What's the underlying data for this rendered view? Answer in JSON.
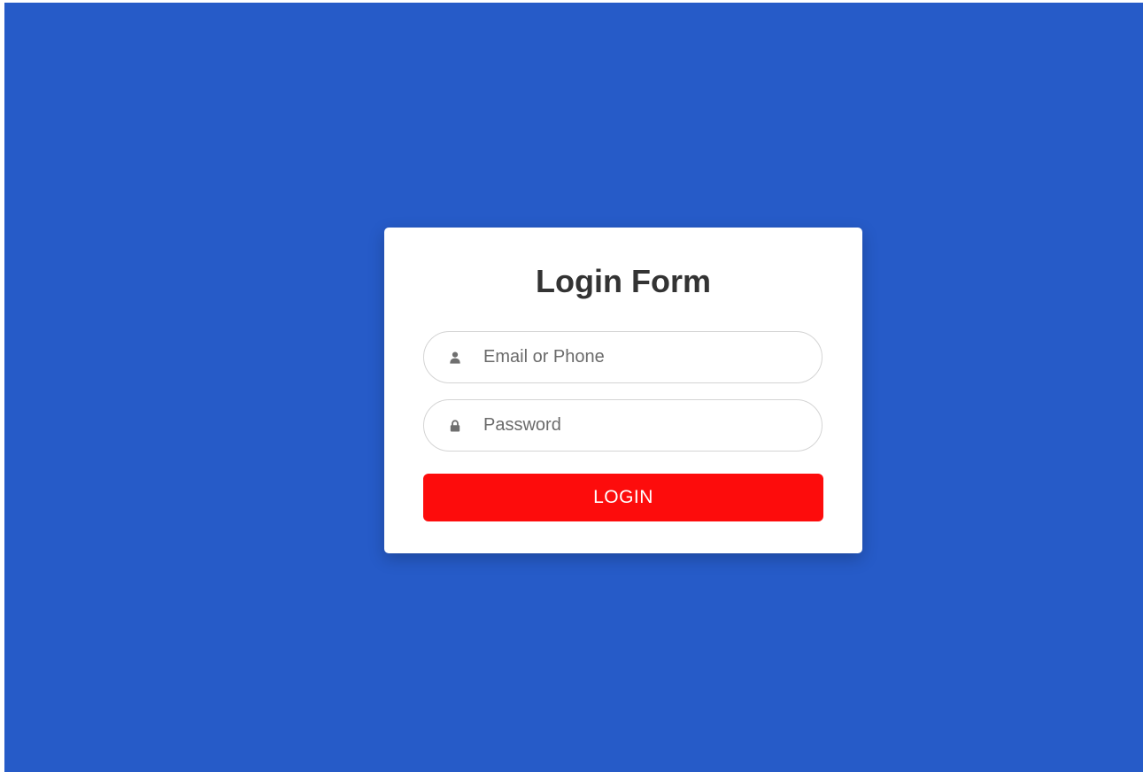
{
  "colors": {
    "background": "#265bc8",
    "card": "#ffffff",
    "button": "#fd0c0c",
    "button_text": "#ffffff",
    "title_text": "#333333",
    "icon": "#6f6f6f"
  },
  "form": {
    "title": "Login Form",
    "email": {
      "placeholder": "Email or Phone",
      "value": "",
      "icon": "user-icon"
    },
    "password": {
      "placeholder": "Password",
      "value": "",
      "icon": "lock-icon"
    },
    "submit_label": "LOGIN"
  }
}
